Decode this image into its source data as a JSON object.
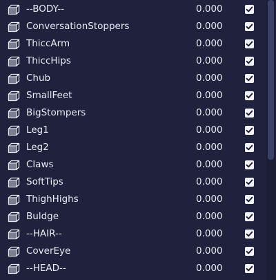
{
  "value_default": "0.000",
  "rows": [
    {
      "name": "--BODY--",
      "value": "0.000",
      "checked": true
    },
    {
      "name": "ConversationStoppers",
      "value": "0.000",
      "checked": true
    },
    {
      "name": "ThiccArm",
      "value": "0.000",
      "checked": true
    },
    {
      "name": "ThiccHips",
      "value": "0.000",
      "checked": true
    },
    {
      "name": "Chub",
      "value": "0.000",
      "checked": true
    },
    {
      "name": "SmallFeet",
      "value": "0.000",
      "checked": true
    },
    {
      "name": "BigStompers",
      "value": "0.000",
      "checked": true
    },
    {
      "name": "Leg1",
      "value": "0.000",
      "checked": true
    },
    {
      "name": "Leg2",
      "value": "0.000",
      "checked": true
    },
    {
      "name": "Claws",
      "value": "0.000",
      "checked": true
    },
    {
      "name": "SoftTips",
      "value": "0.000",
      "checked": true
    },
    {
      "name": "ThighHighs",
      "value": "0.000",
      "checked": true
    },
    {
      "name": "Buldge",
      "value": "0.000",
      "checked": true
    },
    {
      "name": "--HAIR--",
      "value": "0.000",
      "checked": true
    },
    {
      "name": "CoverEye",
      "value": "0.000",
      "checked": true
    },
    {
      "name": "--HEAD--",
      "value": "0.000",
      "checked": true
    }
  ],
  "icon": "cube-icon",
  "scrollbar": {
    "position": 0,
    "visible_fraction": 0.57
  }
}
